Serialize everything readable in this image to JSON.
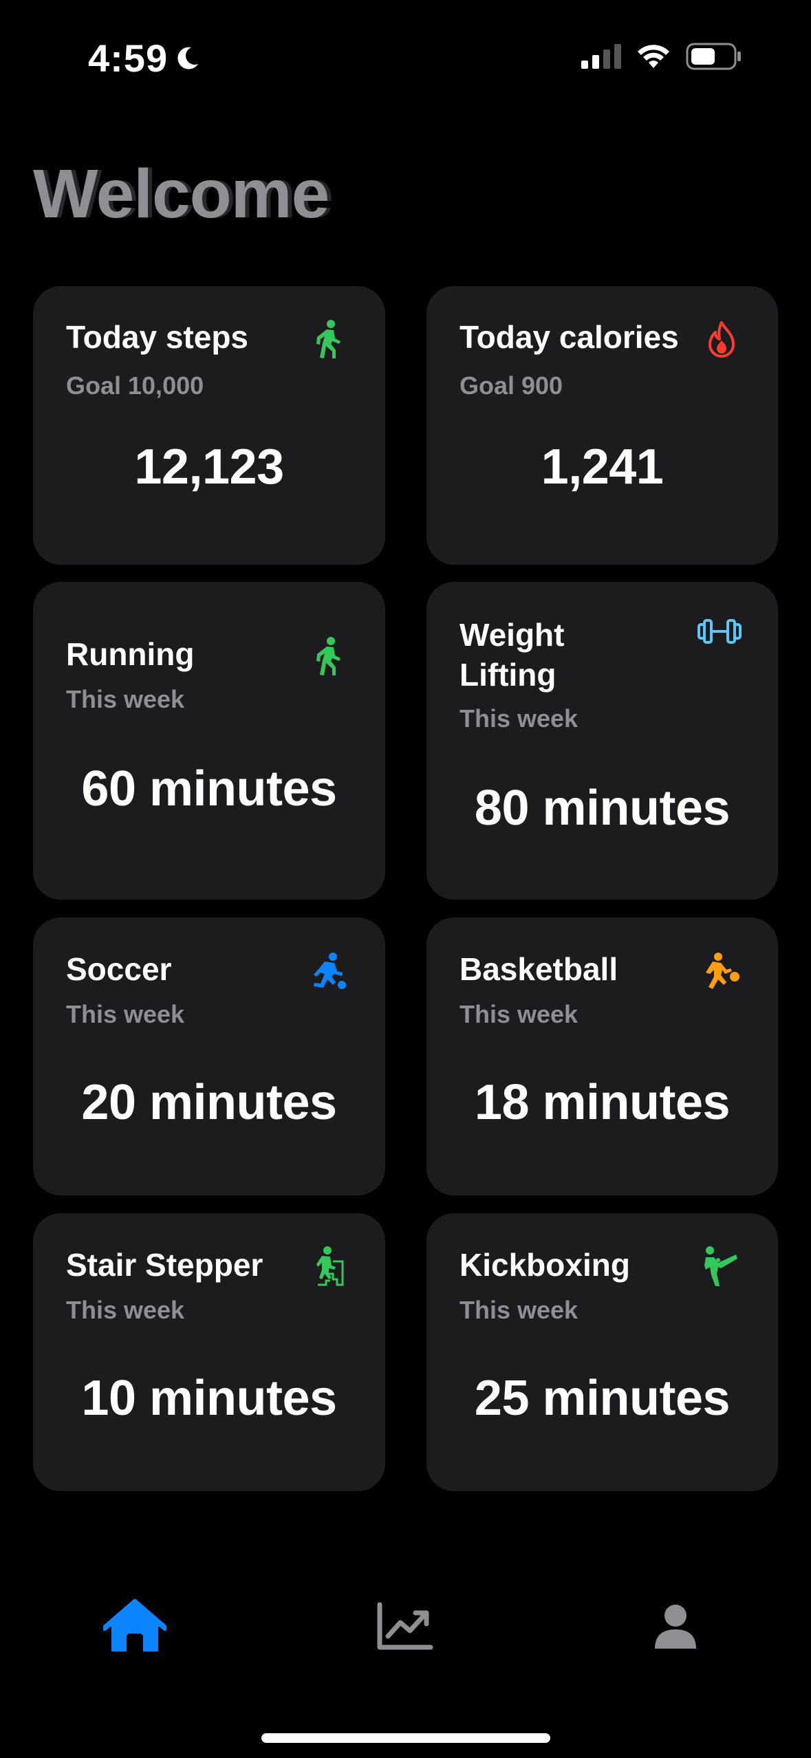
{
  "status_bar": {
    "time": "4:59",
    "moon_icon": "moon-icon",
    "signal_icon": "cellular-signal-icon",
    "wifi_icon": "wifi-icon",
    "battery_icon": "battery-icon"
  },
  "header": {
    "title": "Welcome",
    "ghost_title": "Welcome"
  },
  "cards": [
    {
      "title": "Today steps",
      "subtitle": "Goal 10,000",
      "value": "12,123",
      "icon": "walking-figure-icon",
      "icon_color": "#34c759"
    },
    {
      "title": "Today calories",
      "subtitle": "Goal 900",
      "value": "1,241",
      "icon": "flame-icon",
      "icon_color": "#ff3b30"
    },
    {
      "title": "Running",
      "subtitle": "This week",
      "value": "60 minutes",
      "icon": "walking-figure-icon",
      "icon_color": "#34c759"
    },
    {
      "title": "Weight Lifting",
      "subtitle": "This week",
      "value": "80 minutes",
      "icon": "dumbbell-icon",
      "icon_color": "#5ac8fa"
    },
    {
      "title": "Soccer",
      "subtitle": "This week",
      "value": "20 minutes",
      "icon": "soccer-figure-icon",
      "icon_color": "#0a84ff"
    },
    {
      "title": "Basketball",
      "subtitle": "This week",
      "value": "18 minutes",
      "icon": "basketball-figure-icon",
      "icon_color": "#ff9f0a"
    },
    {
      "title": "Stair Stepper",
      "subtitle": "This week",
      "value": "10 minutes",
      "icon": "stair-stepper-figure-icon",
      "icon_color": "#34c759"
    },
    {
      "title": "Kickboxing",
      "subtitle": "This week",
      "value": "25 minutes",
      "icon": "kickboxing-figure-icon",
      "icon_color": "#34c759"
    }
  ],
  "tab_bar": {
    "active_color": "#0a84ff",
    "inactive_color": "#8e8e93",
    "tabs": [
      {
        "icon": "house-icon",
        "active": true
      },
      {
        "icon": "chart-trend-icon",
        "active": false
      },
      {
        "icon": "person-icon",
        "active": false
      }
    ]
  }
}
